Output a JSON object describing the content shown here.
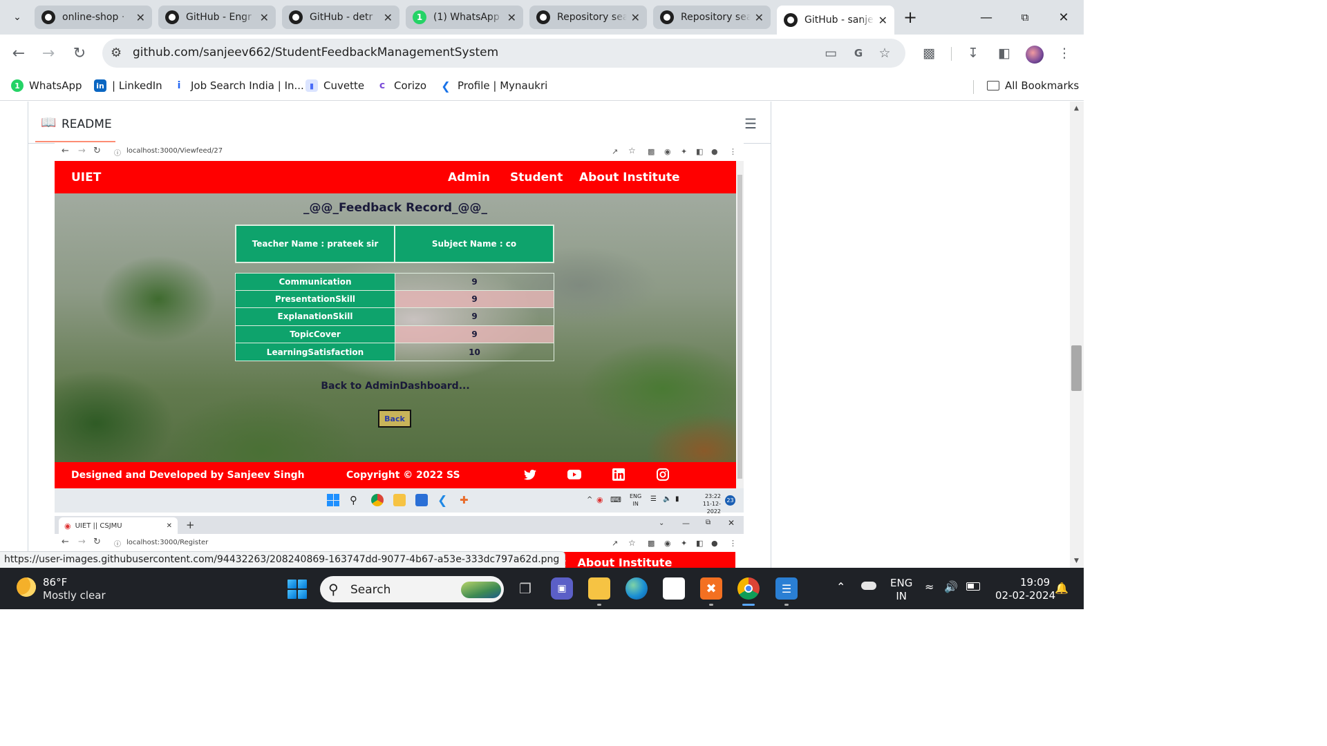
{
  "browser": {
    "tabs": [
      {
        "title": "online-shop · ",
        "icon": "github-icon"
      },
      {
        "title": "GitHub - Engr",
        "icon": "github-icon"
      },
      {
        "title": "GitHub - detr",
        "icon": "github-icon"
      },
      {
        "title": "(1) WhatsApp",
        "icon": "whatsapp-icon",
        "badge": "1"
      },
      {
        "title": "Repository sea",
        "icon": "github-icon"
      },
      {
        "title": "Repository sea",
        "icon": "github-icon"
      },
      {
        "title": "GitHub - sanje",
        "icon": "github-icon",
        "active": true
      }
    ],
    "address": "github.com/sanjeev662/StudentFeedbackManagementSystem",
    "bookmarks": [
      {
        "label": "WhatsApp",
        "icon": "whatsapp-icon",
        "color": "#25d366"
      },
      {
        "label": "| LinkedIn",
        "icon": "linkedin-icon",
        "color": "#0a66c2"
      },
      {
        "label": "Job Search India | In...",
        "icon": "indeed-icon",
        "color": "#2164f3"
      },
      {
        "label": "Cuvette",
        "icon": "cuvette-icon",
        "color": "#4a6cf7"
      },
      {
        "label": "Corizo",
        "icon": "corizo-icon",
        "color": "#7b4cd8"
      },
      {
        "label": "Profile | Mynaukri",
        "icon": "naukri-icon",
        "color": "#1a73e8"
      }
    ],
    "all_bookmarks": "All Bookmarks",
    "status_url": "https://user-images.githubusercontent.com/94432263/208240869-163747dd-9077-4b67-a53e-333dc797a62d.png"
  },
  "readme": {
    "heading": "README"
  },
  "screenshot": {
    "url": "localhost:3000/Viewfeed/27",
    "site": {
      "brand": "UIET",
      "nav": [
        "Admin",
        "Student",
        "About Institute"
      ],
      "title": "_@@_Feedback Record_@@_",
      "teacher": "Teacher Name : prateek sir",
      "subject": "Subject Name : co",
      "scores": [
        {
          "label": "Communication",
          "value": "9"
        },
        {
          "label": "PresentationSkill",
          "value": "9"
        },
        {
          "label": "ExplanationSkill",
          "value": "9"
        },
        {
          "label": "TopicCover",
          "value": "9"
        },
        {
          "label": "LearningSatisfaction",
          "value": "10"
        }
      ],
      "back_text": "Back to AdminDashboard...",
      "back_button": "Back",
      "footer_left": "Designed and Developed by Sanjeev Singh",
      "footer_center": "Copyright © 2022 SS",
      "accent": "#ff0000",
      "table_green": "#0ea36c"
    },
    "taskbar": {
      "lang": "ENG",
      "region": "IN",
      "time": "23:22",
      "date": "11-12-2022",
      "badge": "23"
    }
  },
  "screenshot2": {
    "tab_title": "UIET || CSJMU",
    "url": "localhost:3000/Register",
    "partial_nav": "udent   About Institute"
  },
  "taskbar": {
    "temperature": "86°F",
    "weather": "Mostly clear",
    "search": "Search",
    "lang": "ENG",
    "region": "IN",
    "time": "19:09",
    "date": "02-02-2024"
  }
}
